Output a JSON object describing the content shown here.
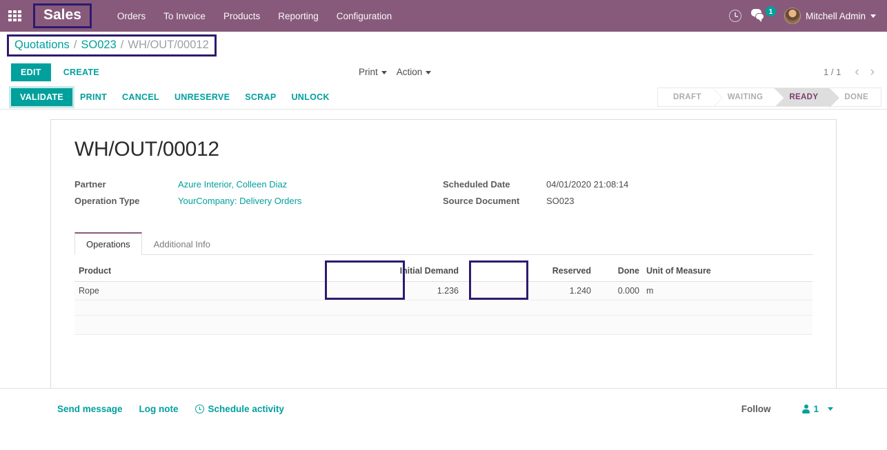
{
  "navbar": {
    "apps_icon": "apps-grid-icon",
    "brand": "Sales",
    "menu": [
      "Orders",
      "To Invoice",
      "Products",
      "Reporting",
      "Configuration"
    ],
    "clock_icon": "clock-icon",
    "chat_icon": "messages-icon",
    "chat_badge": "1",
    "user_name": "Mitchell Admin",
    "avatar": "user-avatar"
  },
  "breadcrumb": {
    "root": "Quotations",
    "sep1": "/",
    "parent": "SO023",
    "sep2": "/",
    "current": "WH/OUT/00012"
  },
  "control_panel": {
    "edit_label": "EDIT",
    "create_label": "CREATE",
    "print_label": "Print",
    "action_label": "Action",
    "pager_text": "1 / 1",
    "prev_icon": "chevron-left-icon",
    "next_icon": "chevron-right-icon"
  },
  "action_bar": {
    "validate_label": "VALIDATE",
    "buttons": [
      "PRINT",
      "CANCEL",
      "UNRESERVE",
      "SCRAP",
      "UNLOCK"
    ],
    "statuses": [
      {
        "label": "DRAFT",
        "active": false
      },
      {
        "label": "WAITING",
        "active": false
      },
      {
        "label": "READY",
        "active": true
      },
      {
        "label": "DONE",
        "active": false
      }
    ]
  },
  "form": {
    "title": "WH/OUT/00012",
    "left_fields": [
      {
        "label": "Partner",
        "value": "Azure Interior, Colleen Diaz",
        "link": true
      },
      {
        "label": "Operation Type",
        "value": "YourCompany: Delivery Orders",
        "link": true
      }
    ],
    "right_fields": [
      {
        "label": "Scheduled Date",
        "value": "04/01/2020 21:08:14",
        "link": false
      },
      {
        "label": "Source Document",
        "value": "SO023",
        "link": false
      }
    ],
    "tabs": [
      {
        "label": "Operations",
        "active": true
      },
      {
        "label": "Additional Info",
        "active": false
      }
    ],
    "table": {
      "headers": [
        "Product",
        "Initial Demand",
        "Reserved",
        "Done",
        "Unit of Measure"
      ],
      "rows": [
        {
          "product": "Rope",
          "initial_demand": "1.236",
          "reserved": "1.240",
          "done": "0.000",
          "uom": "m"
        }
      ]
    }
  },
  "chatter": {
    "send_message": "Send message",
    "log_note": "Log note",
    "schedule_activity": "Schedule activity",
    "schedule_icon": "clock-icon",
    "follow_label": "Follow",
    "followers_icon": "person-icon",
    "followers_count": "1",
    "followers_caret": "caret-down-icon"
  },
  "colors": {
    "brand_purple": "#875A7B",
    "teal": "#00A09D",
    "highlight_box": "#2e1a6e",
    "status_active_text": "#793B6E"
  }
}
